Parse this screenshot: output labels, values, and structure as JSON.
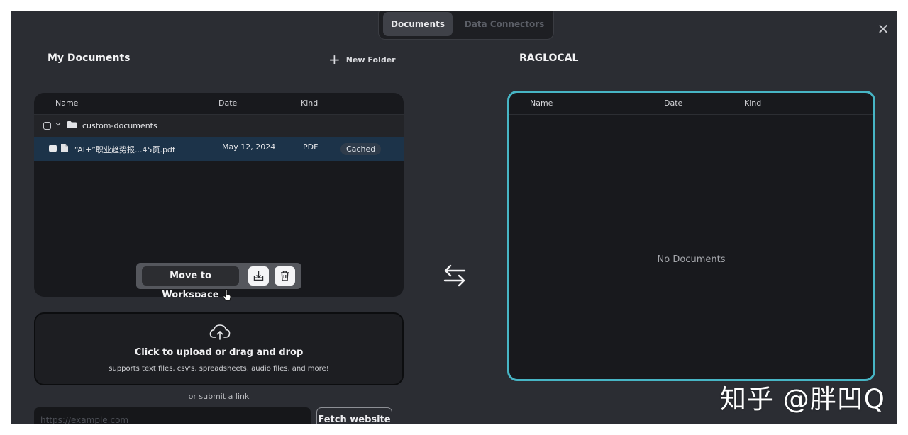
{
  "tabs": [
    {
      "label": "Documents",
      "active": true
    },
    {
      "label": "Data Connectors",
      "active": false
    }
  ],
  "icons": {
    "close": "close-icon",
    "plus": "plus-icon",
    "chevron": "chevron-down-icon",
    "folder": "folder-icon",
    "file": "file-icon",
    "move": "move-to-workspace-icon",
    "trash": "trash-icon",
    "cloud": "cloud-upload-icon",
    "swap": "swap-arrows-icon",
    "cursor": "hand-pointer-icon"
  },
  "my_documents": {
    "title": "My Documents",
    "new_folder_label": "New Folder",
    "columns": [
      "Name",
      "Date",
      "Kind"
    ],
    "folder": {
      "name": "custom-documents"
    },
    "files": [
      {
        "name": "“AI+”职业趋势报...45页.pdf",
        "date": "May 12, 2024",
        "kind": "PDF",
        "status": "Cached"
      }
    ]
  },
  "toolbar": {
    "move_label": "Move to Workspace"
  },
  "upload": {
    "title": "Click to upload or drag and drop",
    "subtitle": "supports text files, csv's, spreadsheets, audio files, and more!",
    "or_submit": "or submit a link",
    "link_placeholder": "https://example.com",
    "fetch_label": "Fetch website"
  },
  "workspace": {
    "title": "RAGLOCAL",
    "columns": [
      "Name",
      "Date",
      "Kind"
    ],
    "empty_text": "No Documents"
  },
  "watermark": "知乎 @胖凹Q",
  "colors": {
    "accent": "#47b5c5",
    "background": "#2b2d33",
    "panel": "#18191d",
    "selected_row": "#1c3349"
  }
}
